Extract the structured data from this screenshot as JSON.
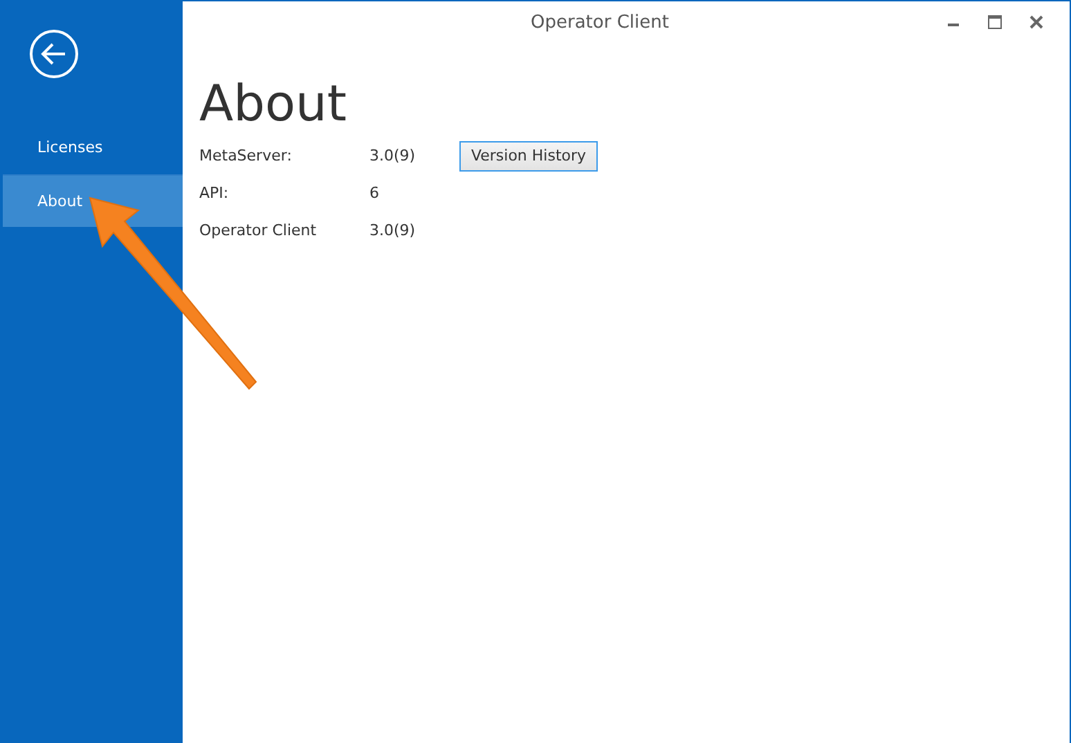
{
  "window": {
    "title": "Operator Client"
  },
  "sidebar": {
    "items": [
      {
        "label": "Licenses",
        "selected": false
      },
      {
        "label": "About",
        "selected": true
      }
    ]
  },
  "page": {
    "heading": "About",
    "rows": [
      {
        "label": "MetaServer:",
        "value": "3.0(9)",
        "button": "Version History"
      },
      {
        "label": "API:",
        "value": "6"
      },
      {
        "label": "Operator Client",
        "value": "3.0(9)"
      }
    ]
  }
}
